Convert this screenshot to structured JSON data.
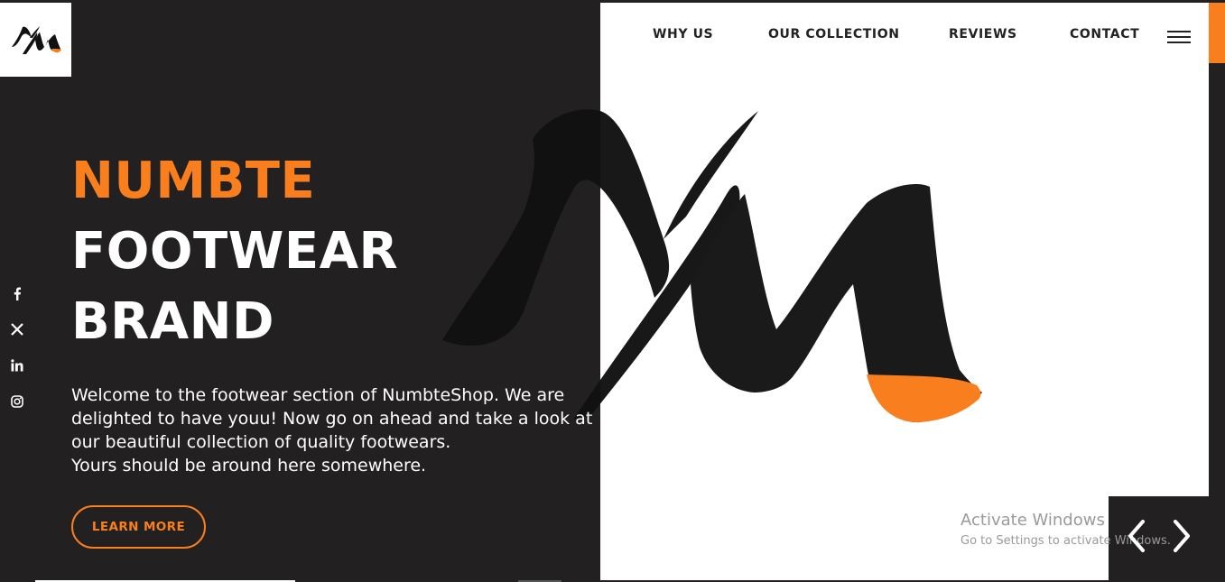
{
  "brand": {
    "logo_icon": "nm-logo-icon",
    "accent_color": "#f97f1e",
    "dark_color": "#222021"
  },
  "nav": {
    "items": [
      {
        "label": "WHY US"
      },
      {
        "label": "OUR COLLECTION"
      },
      {
        "label": "REVIEWS"
      },
      {
        "label": "CONTACT"
      }
    ],
    "menu_icon": "hamburger-menu-icon"
  },
  "hero": {
    "title_line1": "NUMBTE",
    "title_line2": "FOOTWEAR",
    "title_line3": "BRAND",
    "description_lines": [
      "Welcome to the footwear section of NumbteShop. We are",
      "delighted to have youu! Now go on ahead and take a look at",
      "our beautiful collection of quality footwears.",
      "Yours should be around here somewhere."
    ],
    "cta_label": "LEARN MORE"
  },
  "social": {
    "icons": [
      "facebook-icon",
      "x-twitter-icon",
      "linkedin-icon",
      "instagram-icon"
    ]
  },
  "watermark": {
    "line1": "Activate Windows",
    "line2": "Go to Settings to activate Windows."
  },
  "slider": {
    "prev_icon": "chevron-left-icon",
    "next_icon": "chevron-right-icon"
  }
}
